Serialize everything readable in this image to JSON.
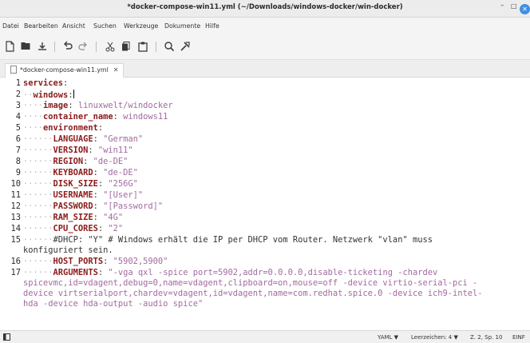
{
  "window": {
    "title": "*docker-compose-win11.yml (~/Downloads/windows-docker/win-docker)",
    "minimize": "–",
    "maximize": "□",
    "close": "✕"
  },
  "menu": [
    "Datei",
    "Bearbeiten",
    "Ansicht",
    "Suchen",
    "Werkzeuge",
    "Dokumente",
    "Hilfe"
  ],
  "tab": {
    "label": "*docker-compose-win11.yml",
    "close": "✕"
  },
  "lines": [
    {
      "n": "1",
      "dots": "",
      "key": "services",
      "colon": ":",
      "value": ""
    },
    {
      "n": "2",
      "dots": "··",
      "key": "windows",
      "colon": ":",
      "value": ""
    },
    {
      "n": "3",
      "dots": "····",
      "key": "image",
      "colon": ": ",
      "value": "linuxwelt/windocker"
    },
    {
      "n": "4",
      "dots": "····",
      "key": "container_name",
      "colon": ": ",
      "value": "windows11"
    },
    {
      "n": "5",
      "dots": "····",
      "key": "environment",
      "colon": ":",
      "value": ""
    },
    {
      "n": "6",
      "dots": "······",
      "key": "LANGUAGE",
      "colon": ": ",
      "value": "\"German\""
    },
    {
      "n": "7",
      "dots": "······",
      "key": "VERSION",
      "colon": ": ",
      "value": "\"win11\""
    },
    {
      "n": "8",
      "dots": "······",
      "key": "REGION",
      "colon": ": ",
      "value": "\"de-DE\""
    },
    {
      "n": "9",
      "dots": "······",
      "key": "KEYBOARD",
      "colon": ": ",
      "value": "\"de-DE\""
    },
    {
      "n": "10",
      "dots": "······",
      "key": "DISK_SIZE",
      "colon": ": ",
      "value": "\"256G\""
    },
    {
      "n": "11",
      "dots": "······",
      "key": "USERNAME",
      "colon": ": ",
      "value": "\"[User]\""
    },
    {
      "n": "12",
      "dots": "······",
      "key": "PASSWORD",
      "colon": ": ",
      "value": "\"[Password]\""
    },
    {
      "n": "13",
      "dots": "······",
      "key": "RAM_SIZE",
      "colon": ": ",
      "value": "\"4G\""
    },
    {
      "n": "14",
      "dots": "······",
      "key": "CPU_CORES",
      "colon": ": ",
      "value": "\"2\""
    }
  ],
  "comment": {
    "n": "15",
    "dots": "······",
    "line1": "#DHCP: \"Y\" # Windows erhält die IP per DHCP vom Router. Netzwerk \"vlan\" muss",
    "line2": "konfiguriert sein."
  },
  "line16": {
    "n": "16",
    "dots": "······",
    "key": "HOST_PORTS",
    "colon": ": ",
    "value": "\"5902,5900\""
  },
  "line17": {
    "n": "17",
    "dots": "······",
    "key": "ARGUMENTS",
    "colon": ": ",
    "wrap": [
      "\"-vga qxl -spice port=5902,addr=0.0.0.0,disable-ticketing -chardev",
      "spicevmc,id=vdagent,debug=0,name=vdagent,clipboard=on,mouse=off -device virtio-serial-pci -",
      "device virtserialport,chardev=vdagent,id=vdagent,name=com.redhat.spice.0 -device ich9-intel-",
      "hda -device hda-output -audio spice\""
    ]
  },
  "status": {
    "language": "YAML ▼",
    "indent": "Leerzeichen: 4 ▼",
    "position": "Z. 2, Sp. 10",
    "mode": "EINF"
  },
  "colors": {
    "key": "#8b1a1a",
    "value": "#a26a9f",
    "whitespace_dots": "#b8b8b8",
    "close_button": "#3d8fe0"
  }
}
